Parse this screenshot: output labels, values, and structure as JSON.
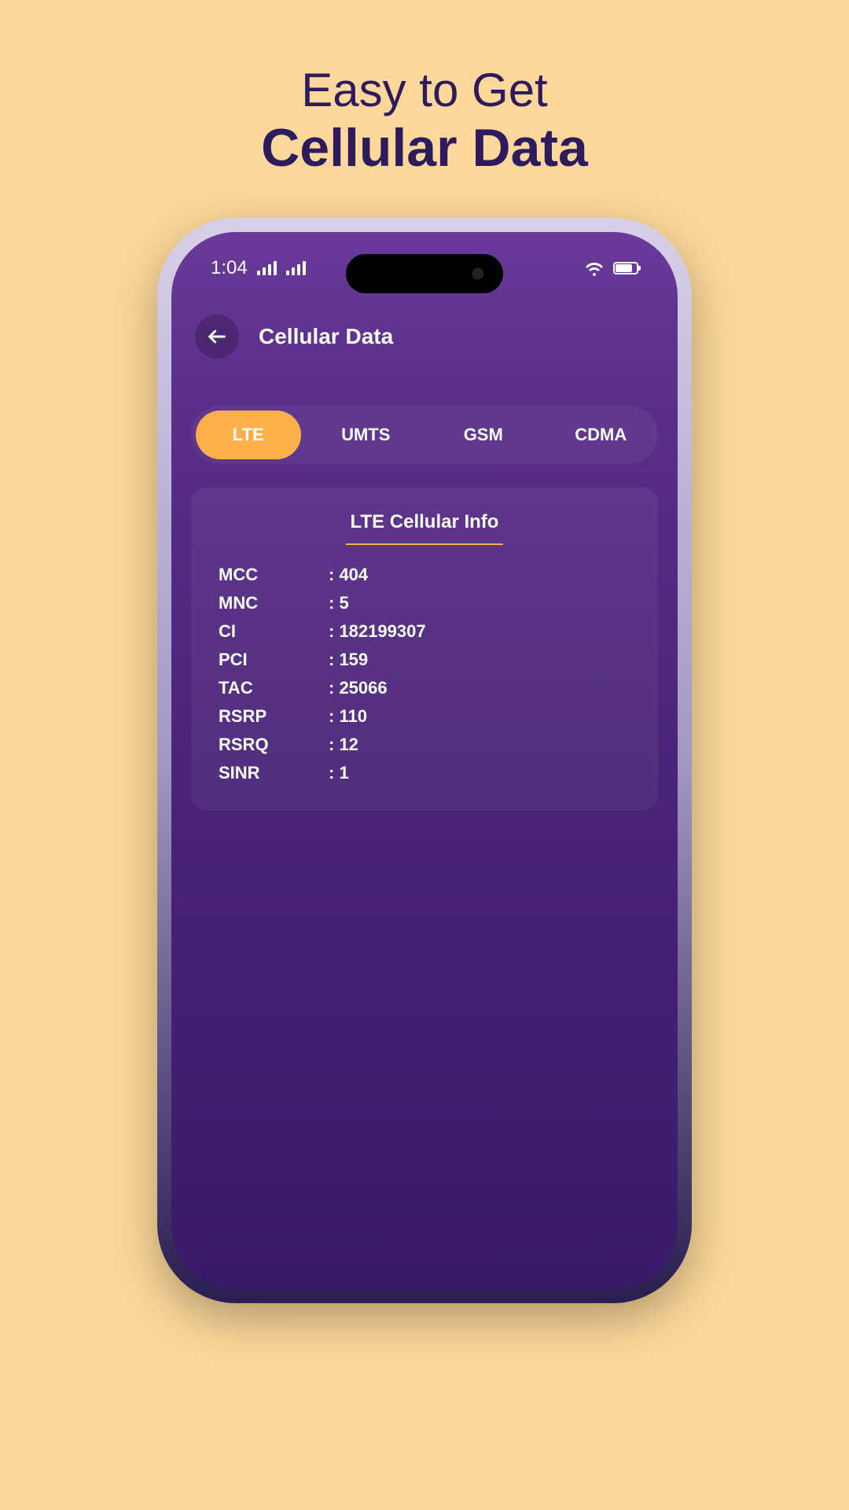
{
  "heading": {
    "line1": "Easy to Get",
    "line2": "Cellular Data"
  },
  "statusBar": {
    "time": "1:04"
  },
  "header": {
    "title": "Cellular Data"
  },
  "tabs": [
    {
      "label": "LTE",
      "active": true
    },
    {
      "label": "UMTS",
      "active": false
    },
    {
      "label": "GSM",
      "active": false
    },
    {
      "label": "CDMA",
      "active": false
    }
  ],
  "card": {
    "title": "LTE Cellular Info",
    "rows": [
      {
        "key": "MCC",
        "value": ": 404"
      },
      {
        "key": "MNC",
        "value": ": 5"
      },
      {
        "key": "CI",
        "value": ": 182199307"
      },
      {
        "key": "PCI",
        "value": ": 159"
      },
      {
        "key": "TAC",
        "value": ": 25066"
      },
      {
        "key": "RSRP",
        "value": ": 110"
      },
      {
        "key": "RSRQ",
        "value": ": 12"
      },
      {
        "key": "SINR",
        "value": ": 1"
      }
    ]
  }
}
